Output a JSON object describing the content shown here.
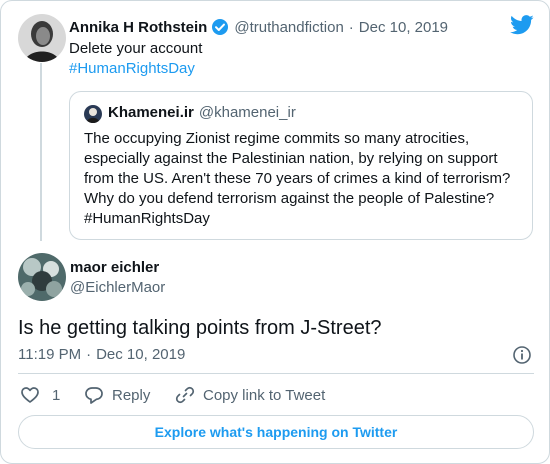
{
  "colors": {
    "accent": "#1d9bf0",
    "text": "#0f1419",
    "muted": "#536471",
    "border": "#cfd9de"
  },
  "header_icon": "twitter-bird-icon",
  "parent_tweet": {
    "author_name": "Annika H Rothstein",
    "verified_icon": "verified-badge-icon",
    "handle": "@truthandfiction",
    "separator": "·",
    "date": "Dec 10, 2019",
    "text": "Delete your account",
    "hashtag": "#HumanRightsDay"
  },
  "quoted_tweet": {
    "author_name": "Khamenei.ir",
    "handle": "@khamenei_ir",
    "lines": [
      "The occupying Zionist regime commits so many atrocities,",
      "especially against the Palestinian nation, by relying on support",
      "from the US. Aren't these 70 years of crimes a kind of terrorism?",
      "Why do you defend terrorism against the people of Palestine?",
      "#HumanRightsDay"
    ]
  },
  "main_tweet": {
    "author_name": "maor eichler",
    "handle": "@EichlerMaor",
    "text": "Is he getting talking points from J-Street?",
    "time": "11:19 PM",
    "separator": "·",
    "date": "Dec 10, 2019",
    "info_icon": "info-icon"
  },
  "actions": {
    "like_count": "1",
    "reply_label": "Reply",
    "copy_link_label": "Copy link to Tweet"
  },
  "footer": {
    "explore_label": "Explore what's happening on Twitter"
  }
}
